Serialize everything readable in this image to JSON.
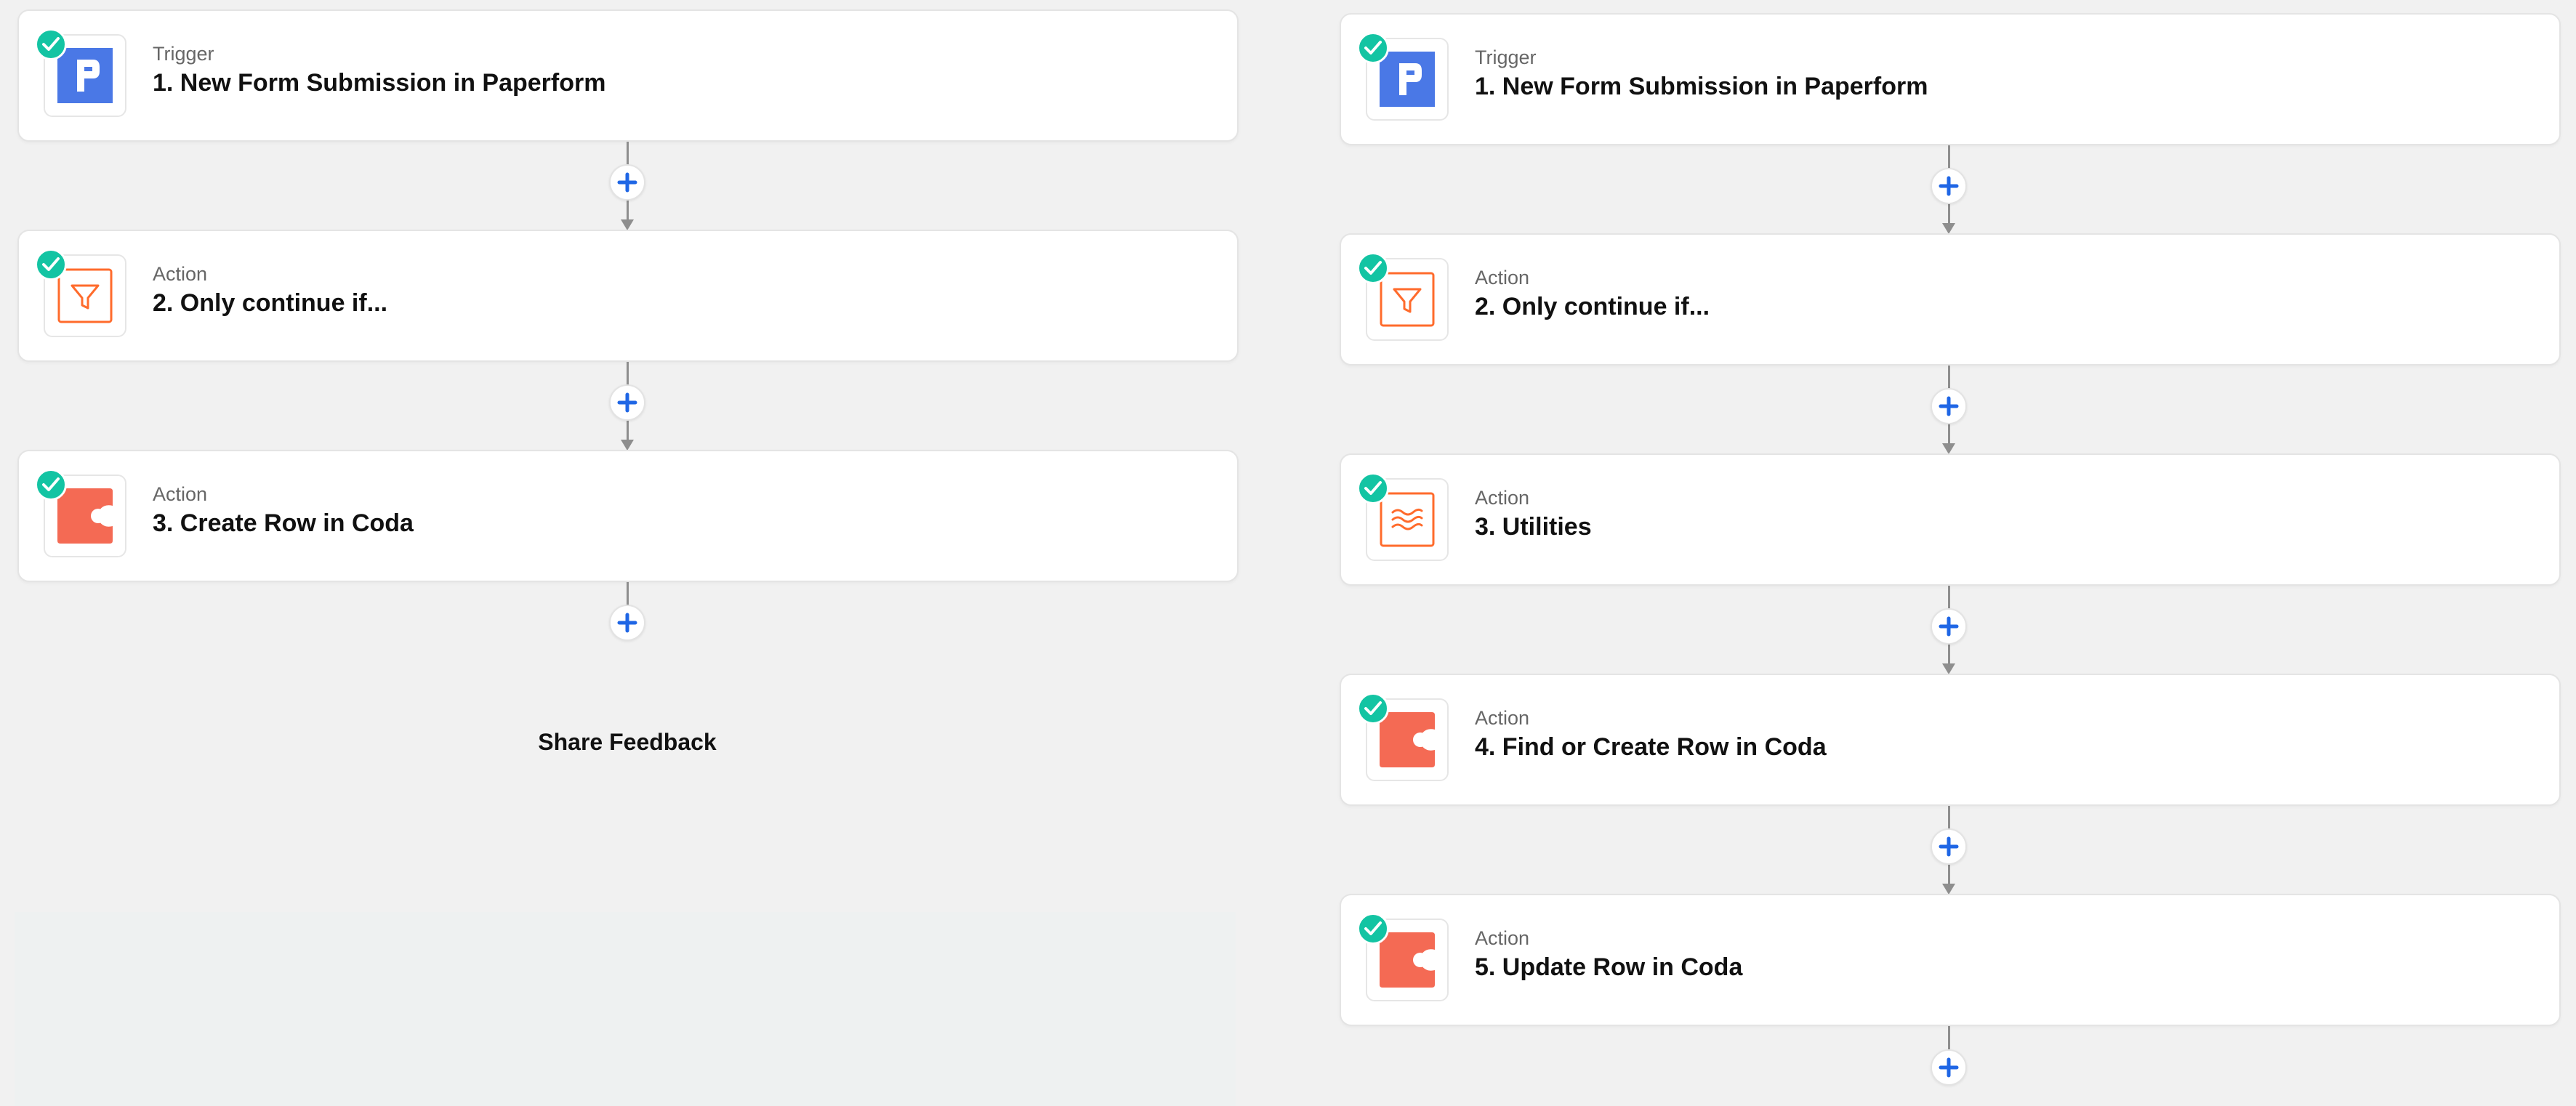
{
  "left_zap": {
    "steps": [
      {
        "type": "Trigger",
        "title": "1. New Form Submission in Paperform",
        "app_icon": "paperform-icon"
      },
      {
        "type": "Action",
        "title": "2. Only continue if...",
        "app_icon": "filter-icon"
      },
      {
        "type": "Action",
        "title": "3. Create Row in Coda",
        "app_icon": "coda-icon"
      }
    ],
    "feedback_label": "Share Feedback"
  },
  "right_zap": {
    "steps": [
      {
        "type": "Trigger",
        "title": "1. New Form Submission in Paperform",
        "app_icon": "paperform-icon"
      },
      {
        "type": "Action",
        "title": "2. Only continue if...",
        "app_icon": "filter-icon"
      },
      {
        "type": "Action",
        "title": "3. Utilities",
        "app_icon": "utilities-icon"
      },
      {
        "type": "Action",
        "title": "4. Find or Create Row in Coda",
        "app_icon": "coda-icon"
      },
      {
        "type": "Action",
        "title": "5. Update Row in Coda",
        "app_icon": "coda-icon"
      }
    ]
  },
  "colors": {
    "check_green": "#13c4a3",
    "paperform_blue": "#4a78e6",
    "filter_orange": "#ff6b2c",
    "coda_red": "#f46a54",
    "add_plus_blue": "#1f66e5"
  }
}
